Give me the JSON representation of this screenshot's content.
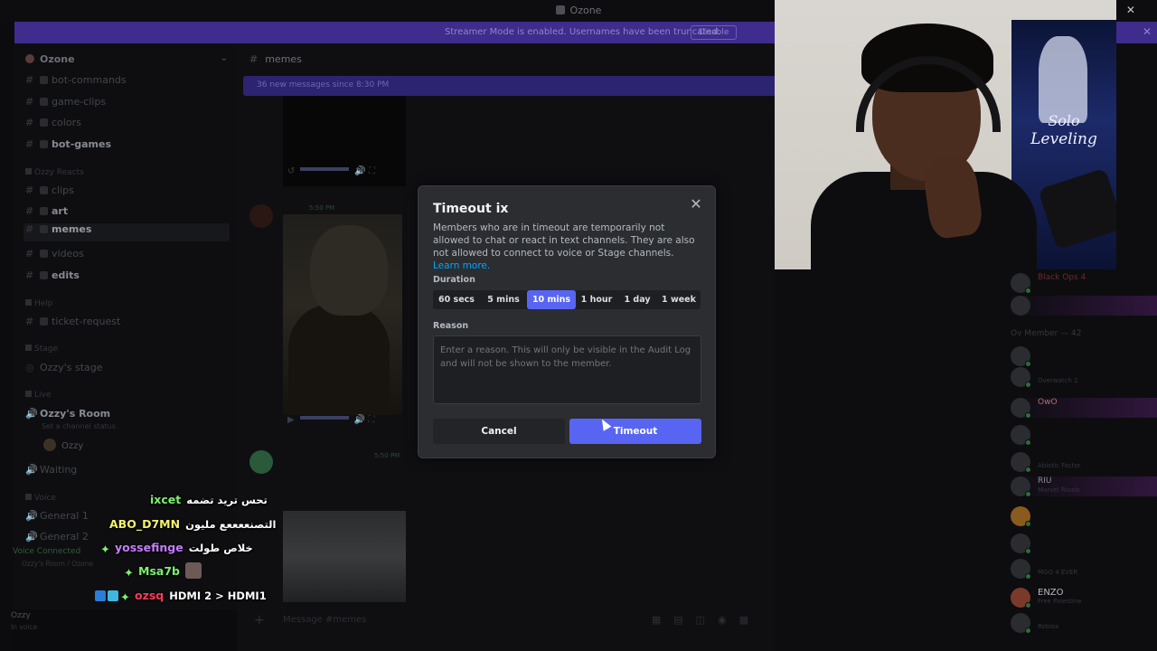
{
  "window": {
    "title": "Ozone",
    "controls": "◻ ✕"
  },
  "streamer_mode": {
    "message": "Streamer Mode is enabled. Usernames have been truncated.",
    "disable_label": "Disable",
    "close": "✕"
  },
  "server": {
    "name": "Ozone",
    "chevron": "⌄"
  },
  "sidebar": {
    "channels": [
      {
        "name": "bot-commands"
      },
      {
        "name": "game-clips"
      },
      {
        "name": "colors"
      },
      {
        "name": "bot-games"
      },
      {
        "name": "clips"
      },
      {
        "name": "art"
      },
      {
        "name": "memes"
      },
      {
        "name": "videos"
      },
      {
        "name": "edits"
      },
      {
        "name": "ticket-request"
      }
    ],
    "categories": {
      "ozzy_reacts": "Ozzy Reacts",
      "help": "Help",
      "stage": "Stage",
      "live": "Live",
      "voice": "Voice"
    },
    "stage_channel": "Ozzy's stage",
    "voice_room": "Ozzy's Room",
    "voice_room_status": "Set a channel status",
    "voice_user": "Ozzy",
    "waiting": "Waiting",
    "general_1": "General 1",
    "general_2": "General 2",
    "voice_connected": "Voice Connected",
    "voice_location": "Ozzy's Room / Ozone",
    "user": {
      "name": "Ozzy",
      "status": "In voice"
    }
  },
  "chat": {
    "channel": "memes",
    "new_messages": "36 new messages since 8:30 PM",
    "timestamp_1": "5:50 PM",
    "timestamp_2": "5:50 PM",
    "input_placeholder": "Message #memes"
  },
  "members": {
    "section": "Ov Member — 42",
    "list": [
      {
        "name": "Black Ops 4",
        "sub": ""
      },
      {
        "name": "Overwatch 2",
        "sub": "Overwatch 2"
      },
      {
        "name": "OwO",
        "sub": ""
      },
      {
        "name": "Abiotic Factor",
        "sub": "Abiotic Factor"
      },
      {
        "name": "RIU",
        "sub": "Marvel Rivals"
      },
      {
        "name": "MGO 4 EVER",
        "sub": "MGO 4 EVER"
      },
      {
        "name": "ENZO",
        "sub": "Free Palestine"
      },
      {
        "name": "Roblox",
        "sub": "Roblox"
      }
    ]
  },
  "webcam": {
    "poster_line1": "Solo",
    "poster_line2": "Leveling"
  },
  "modal": {
    "title": "Timeout ix",
    "description": "Members who are in timeout are temporarily not allowed to chat or react in text channels. They are also not allowed to connect to voice or Stage channels.",
    "learn_more": "Learn more.",
    "duration_label": "Duration",
    "durations": [
      "60 secs",
      "5 mins",
      "10 mins",
      "1 hour",
      "1 day",
      "1 week"
    ],
    "selected_duration": "10 mins",
    "reason_label": "Reason",
    "reason_placeholder": "Enter a reason. This will only be visible in the Audit Log and will not be shown to the member.",
    "cancel_label": "Cancel",
    "timeout_label": "Timeout",
    "close": "✕"
  },
  "stream_chat": [
    {
      "name": "ixcet",
      "text": "تحس تريد تضمه",
      "color": "#7cf26b"
    },
    {
      "name": "ABO_D7MN",
      "text": "التصنععععع مليون",
      "color": "#f3f26d"
    },
    {
      "name": "yossefinge",
      "text": "خلاص طولت",
      "color": "#c77dff"
    },
    {
      "name": "Msa7b",
      "text": "",
      "color": "#7cf26b"
    },
    {
      "name": "ozsq",
      "text": "HDMI 2 > HDMI1",
      "color": "#ff3b5c"
    }
  ],
  "colors": {
    "accent": "#5865f2",
    "streamer_bar": "#3f2c8c",
    "modal_bg": "#2b2d31"
  }
}
